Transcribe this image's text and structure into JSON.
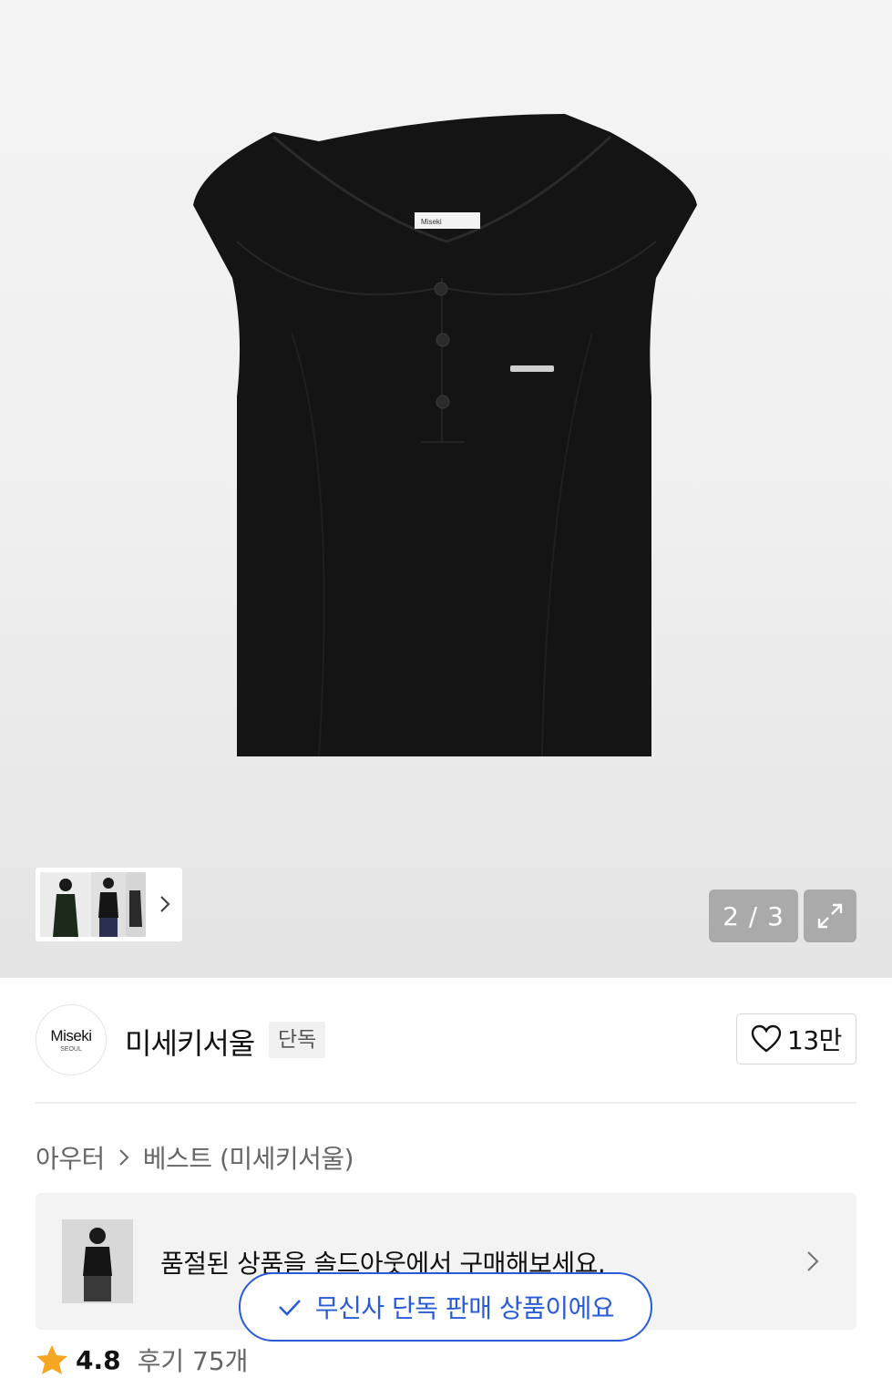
{
  "gallery": {
    "current_index": 2,
    "total": 3,
    "counter_text": "2 / 3",
    "garment_label": "Miseki"
  },
  "brand": {
    "logo_text": "Miseki",
    "logo_sub": "SEOUL",
    "name": "미세키서울",
    "badge": "단독",
    "likes": "13만"
  },
  "breadcrumb": {
    "category": "아우터",
    "subcategory": "베스트 (미세키서울)"
  },
  "promo": {
    "text": "품절된 상품을 솔드아웃에서 구매해보세요."
  },
  "toast": {
    "text": "무신사 단독 판매 상품이에요"
  },
  "rating": {
    "score": "4.8",
    "reviews": "후기 75개"
  },
  "colors": {
    "accent_blue": "#2a5bd7",
    "star_orange": "#f5a623"
  }
}
